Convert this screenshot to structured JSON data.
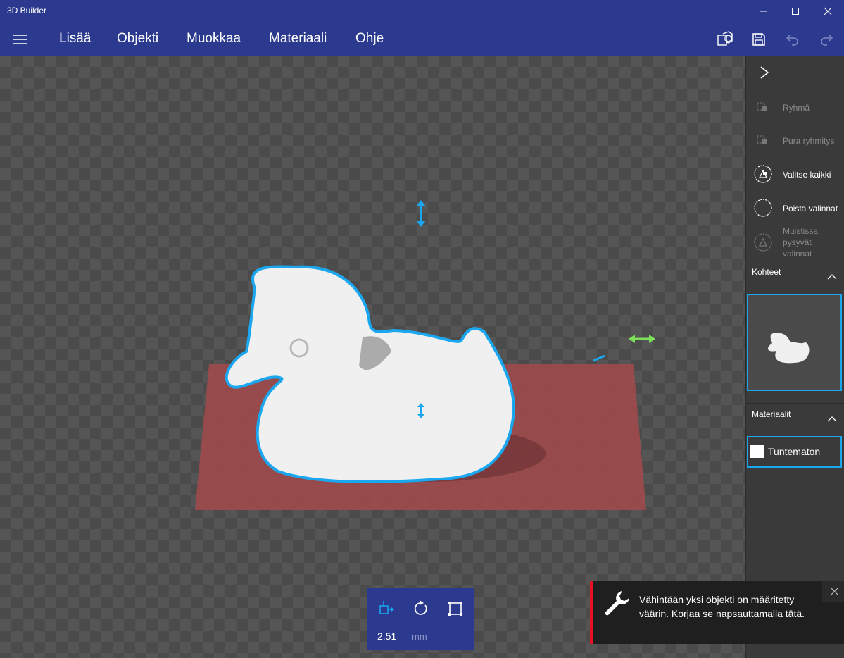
{
  "window": {
    "title": "3D Builder"
  },
  "menu": {
    "items": [
      "Lisää",
      "Objekti",
      "Muokkaa",
      "Materiaali",
      "Ohje"
    ]
  },
  "side": {
    "actions": [
      {
        "label": "Ryhmä",
        "enabled": false
      },
      {
        "label": "Pura ryhmitys",
        "enabled": false
      },
      {
        "label": "Valitse kaikki",
        "enabled": true
      },
      {
        "label": "Poista valinnat",
        "enabled": true
      },
      {
        "label": "Muistissa pysyvät valinnat",
        "enabled": false
      }
    ],
    "objects_header": "Kohteet",
    "materials_header": "Materiaalit",
    "material_name": "Tuntematon"
  },
  "toolbox": {
    "value": "2,51",
    "unit": "mm"
  },
  "toast": {
    "message": "Vähintään yksi objekti on määritetty väärin. Korjaa se napsauttamalla tätä."
  },
  "colors": {
    "accent": "#2b3a8e",
    "selection": "#1aa7f0",
    "build_plate": "#a34a4c",
    "error": "#e81123"
  }
}
